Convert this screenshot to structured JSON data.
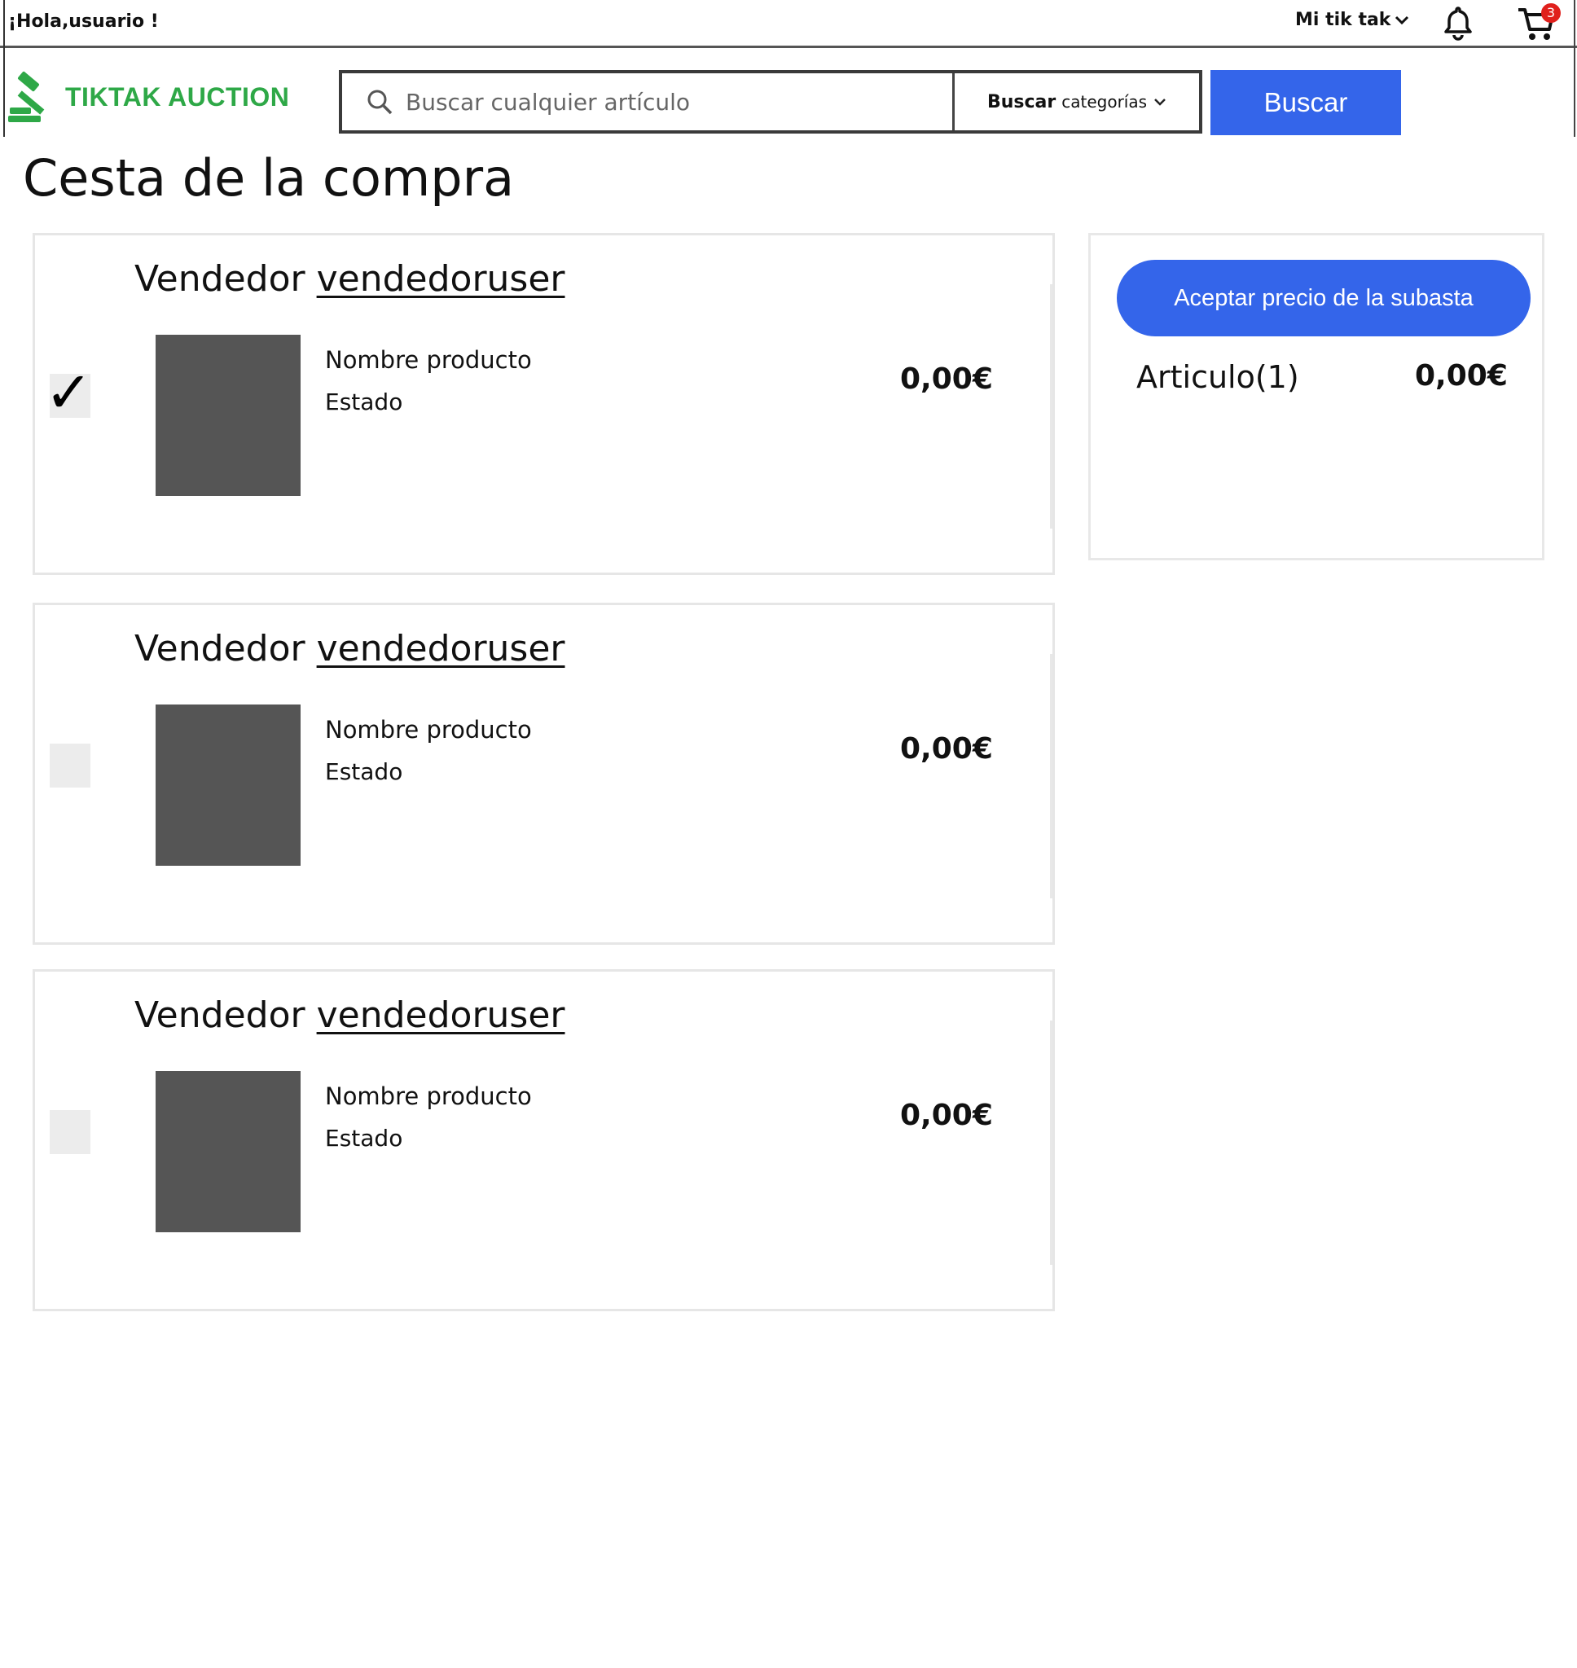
{
  "header": {
    "greeting": "¡Hola,usuario !",
    "my_tiktak": "Mi tik tak",
    "cart_count": "3",
    "brand": "TIKTAK AUCTION"
  },
  "search": {
    "placeholder": "Buscar cualquier artículo",
    "category_bold": "Buscar",
    "category_rest": "categorías",
    "button": "Buscar"
  },
  "page": {
    "title": "Cesta de la compra"
  },
  "cart_items": [
    {
      "seller_prefix": "Vendedor",
      "seller_name": "vendedoruser",
      "product_name": "Nombre producto",
      "state": "Estado",
      "price": "0,00€",
      "checked": true
    },
    {
      "seller_prefix": "Vendedor",
      "seller_name": "vendedoruser",
      "product_name": "Nombre producto",
      "state": "Estado",
      "price": "0,00€",
      "checked": false
    },
    {
      "seller_prefix": "Vendedor",
      "seller_name": "vendedoruser",
      "product_name": "Nombre producto",
      "state": "Estado",
      "price": "0,00€",
      "checked": false
    }
  ],
  "summary": {
    "button": "Aceptar precio de la subasta",
    "items_label": "Articulo(1)",
    "total": "0,00€"
  },
  "icons": {
    "search": "search-icon",
    "bell": "bell-icon",
    "cart": "cart-icon",
    "chevron": "chevron-down-icon",
    "gavel": "gavel-logo-icon",
    "checkmark": "checkmark-icon"
  },
  "colors": {
    "accent": "#3465ea",
    "brand_green": "#2ea847",
    "badge_red": "#e0201c",
    "thumbnail": "#555555"
  }
}
